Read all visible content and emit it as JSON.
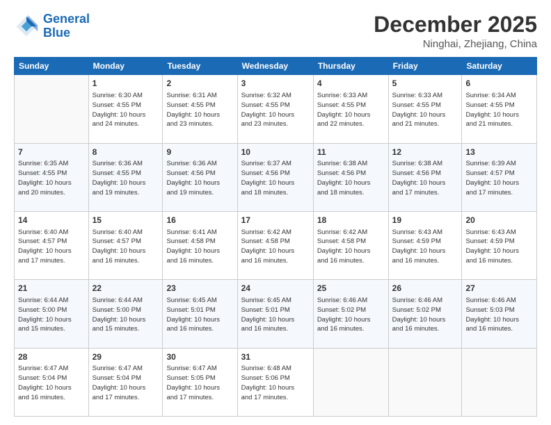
{
  "logo": {
    "line1": "General",
    "line2": "Blue"
  },
  "title": "December 2025",
  "subtitle": "Ninghai, Zhejiang, China",
  "weekdays": [
    "Sunday",
    "Monday",
    "Tuesday",
    "Wednesday",
    "Thursday",
    "Friday",
    "Saturday"
  ],
  "weeks": [
    [
      {
        "day": "",
        "info": ""
      },
      {
        "day": "1",
        "info": "Sunrise: 6:30 AM\nSunset: 4:55 PM\nDaylight: 10 hours\nand 24 minutes."
      },
      {
        "day": "2",
        "info": "Sunrise: 6:31 AM\nSunset: 4:55 PM\nDaylight: 10 hours\nand 23 minutes."
      },
      {
        "day": "3",
        "info": "Sunrise: 6:32 AM\nSunset: 4:55 PM\nDaylight: 10 hours\nand 23 minutes."
      },
      {
        "day": "4",
        "info": "Sunrise: 6:33 AM\nSunset: 4:55 PM\nDaylight: 10 hours\nand 22 minutes."
      },
      {
        "day": "5",
        "info": "Sunrise: 6:33 AM\nSunset: 4:55 PM\nDaylight: 10 hours\nand 21 minutes."
      },
      {
        "day": "6",
        "info": "Sunrise: 6:34 AM\nSunset: 4:55 PM\nDaylight: 10 hours\nand 21 minutes."
      }
    ],
    [
      {
        "day": "7",
        "info": "Sunrise: 6:35 AM\nSunset: 4:55 PM\nDaylight: 10 hours\nand 20 minutes."
      },
      {
        "day": "8",
        "info": "Sunrise: 6:36 AM\nSunset: 4:55 PM\nDaylight: 10 hours\nand 19 minutes."
      },
      {
        "day": "9",
        "info": "Sunrise: 6:36 AM\nSunset: 4:56 PM\nDaylight: 10 hours\nand 19 minutes."
      },
      {
        "day": "10",
        "info": "Sunrise: 6:37 AM\nSunset: 4:56 PM\nDaylight: 10 hours\nand 18 minutes."
      },
      {
        "day": "11",
        "info": "Sunrise: 6:38 AM\nSunset: 4:56 PM\nDaylight: 10 hours\nand 18 minutes."
      },
      {
        "day": "12",
        "info": "Sunrise: 6:38 AM\nSunset: 4:56 PM\nDaylight: 10 hours\nand 17 minutes."
      },
      {
        "day": "13",
        "info": "Sunrise: 6:39 AM\nSunset: 4:57 PM\nDaylight: 10 hours\nand 17 minutes."
      }
    ],
    [
      {
        "day": "14",
        "info": "Sunrise: 6:40 AM\nSunset: 4:57 PM\nDaylight: 10 hours\nand 17 minutes."
      },
      {
        "day": "15",
        "info": "Sunrise: 6:40 AM\nSunset: 4:57 PM\nDaylight: 10 hours\nand 16 minutes."
      },
      {
        "day": "16",
        "info": "Sunrise: 6:41 AM\nSunset: 4:58 PM\nDaylight: 10 hours\nand 16 minutes."
      },
      {
        "day": "17",
        "info": "Sunrise: 6:42 AM\nSunset: 4:58 PM\nDaylight: 10 hours\nand 16 minutes."
      },
      {
        "day": "18",
        "info": "Sunrise: 6:42 AM\nSunset: 4:58 PM\nDaylight: 10 hours\nand 16 minutes."
      },
      {
        "day": "19",
        "info": "Sunrise: 6:43 AM\nSunset: 4:59 PM\nDaylight: 10 hours\nand 16 minutes."
      },
      {
        "day": "20",
        "info": "Sunrise: 6:43 AM\nSunset: 4:59 PM\nDaylight: 10 hours\nand 16 minutes."
      }
    ],
    [
      {
        "day": "21",
        "info": "Sunrise: 6:44 AM\nSunset: 5:00 PM\nDaylight: 10 hours\nand 15 minutes."
      },
      {
        "day": "22",
        "info": "Sunrise: 6:44 AM\nSunset: 5:00 PM\nDaylight: 10 hours\nand 15 minutes."
      },
      {
        "day": "23",
        "info": "Sunrise: 6:45 AM\nSunset: 5:01 PM\nDaylight: 10 hours\nand 16 minutes."
      },
      {
        "day": "24",
        "info": "Sunrise: 6:45 AM\nSunset: 5:01 PM\nDaylight: 10 hours\nand 16 minutes."
      },
      {
        "day": "25",
        "info": "Sunrise: 6:46 AM\nSunset: 5:02 PM\nDaylight: 10 hours\nand 16 minutes."
      },
      {
        "day": "26",
        "info": "Sunrise: 6:46 AM\nSunset: 5:02 PM\nDaylight: 10 hours\nand 16 minutes."
      },
      {
        "day": "27",
        "info": "Sunrise: 6:46 AM\nSunset: 5:03 PM\nDaylight: 10 hours\nand 16 minutes."
      }
    ],
    [
      {
        "day": "28",
        "info": "Sunrise: 6:47 AM\nSunset: 5:04 PM\nDaylight: 10 hours\nand 16 minutes."
      },
      {
        "day": "29",
        "info": "Sunrise: 6:47 AM\nSunset: 5:04 PM\nDaylight: 10 hours\nand 17 minutes."
      },
      {
        "day": "30",
        "info": "Sunrise: 6:47 AM\nSunset: 5:05 PM\nDaylight: 10 hours\nand 17 minutes."
      },
      {
        "day": "31",
        "info": "Sunrise: 6:48 AM\nSunset: 5:06 PM\nDaylight: 10 hours\nand 17 minutes."
      },
      {
        "day": "",
        "info": ""
      },
      {
        "day": "",
        "info": ""
      },
      {
        "day": "",
        "info": ""
      }
    ]
  ]
}
